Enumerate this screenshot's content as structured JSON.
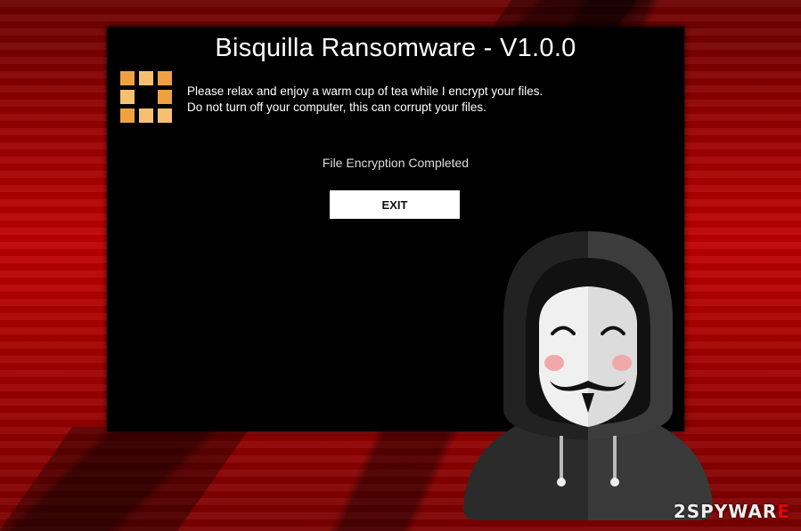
{
  "window": {
    "title": "Bisquilla Ransomware - V1.0.0",
    "message_line1": "Please relax and enjoy a warm cup of tea while I encrypt your files.",
    "message_line2": "Do not turn off your computer, this can corrupt your files.",
    "status": "File Encryption Completed",
    "exit_label": "EXIT",
    "logo_icon": "orange-grid-logo-icon"
  },
  "illustration": {
    "icon": "hooded-anonymous-hacker-icon"
  },
  "watermark": {
    "prefix": "2",
    "text": "SPYWAR",
    "suffix": "E"
  },
  "colors": {
    "background": "#b00000",
    "window": "#000000",
    "logo": "#f0a040",
    "button": "#ffffff"
  }
}
